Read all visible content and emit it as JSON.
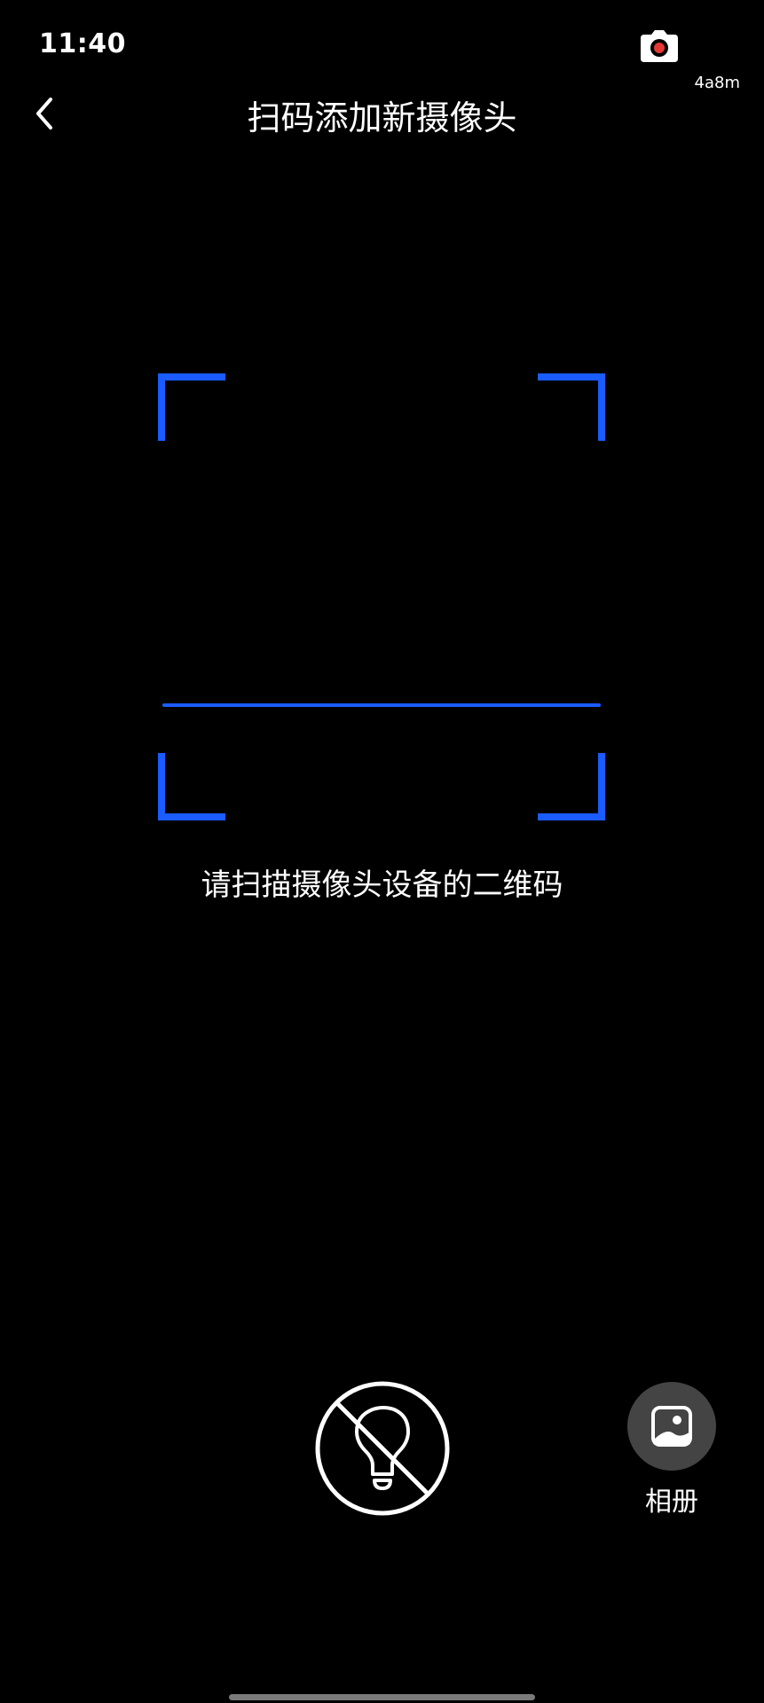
{
  "status_bar": {
    "time": "11:40",
    "camera_icon": "camera-recording-icon",
    "data_rate": "4a8m"
  },
  "header": {
    "back_icon": "chevron-left-icon",
    "title": "扫码添加新摄像头"
  },
  "scanner": {
    "accent_color": "#1a5cff",
    "hint": "请扫描摄像头设备的二维码"
  },
  "controls": {
    "flash_icon": "flashlight-off-icon",
    "album_icon": "image-gallery-icon",
    "album_label": "相册"
  }
}
